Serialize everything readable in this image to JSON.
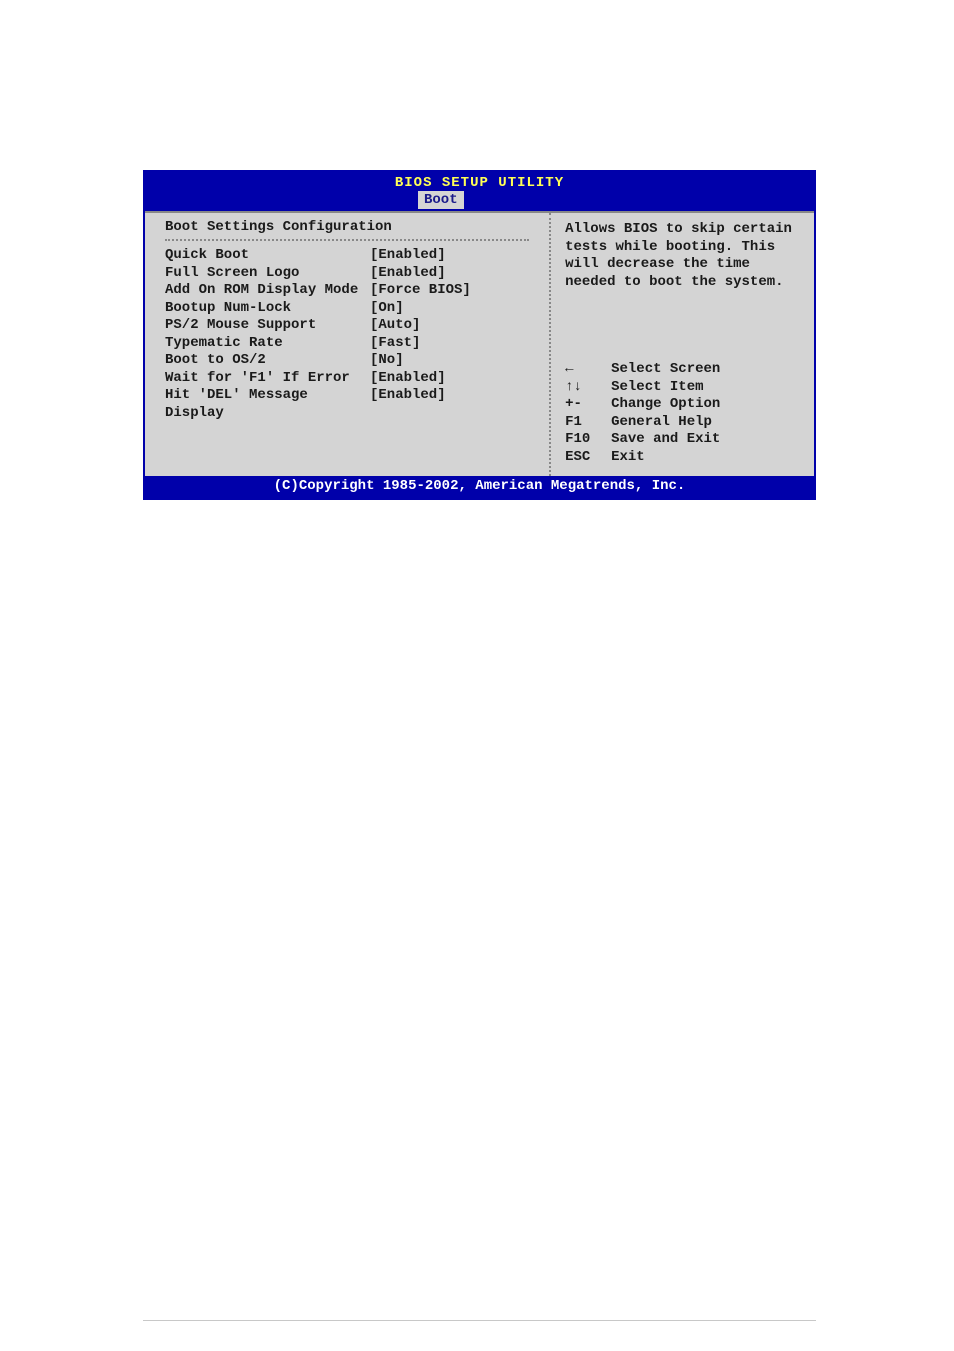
{
  "header": {
    "title": "BIOS SETUP UTILITY",
    "active_tab": "Boot"
  },
  "left": {
    "section_title": "Boot Settings Configuration",
    "settings": [
      {
        "label": "Quick Boot",
        "value": "[Enabled]"
      },
      {
        "label": "Full Screen Logo",
        "value": "[Enabled]"
      },
      {
        "label": "Add On ROM Display Mode",
        "value": "[Force BIOS]"
      },
      {
        "label": "Bootup Num-Lock",
        "value": "[On]"
      },
      {
        "label": "PS/2 Mouse Support",
        "value": "[Auto]"
      },
      {
        "label": "Typematic Rate",
        "value": "[Fast]"
      },
      {
        "label": "Boot to OS/2",
        "value": "[No]"
      },
      {
        "label": "Wait for 'F1' If Error",
        "value": "[Enabled]"
      },
      {
        "label": "Hit 'DEL' Message Display",
        "value": "[Enabled]"
      }
    ]
  },
  "right": {
    "help_text": "Allows BIOS to skip certain tests while booting. This will decrease the time needed to boot the system.",
    "nav": [
      {
        "key": "←",
        "desc": "Select Screen"
      },
      {
        "key": "↑↓",
        "desc": "Select Item"
      },
      {
        "key": "+-",
        "desc": "Change Option"
      },
      {
        "key": "F1",
        "desc": "General Help"
      },
      {
        "key": "F10",
        "desc": "Save and Exit"
      },
      {
        "key": "ESC",
        "desc": "Exit"
      }
    ]
  },
  "footer": {
    "copyright": "(C)Copyright 1985-2002, American Megatrends, Inc."
  }
}
